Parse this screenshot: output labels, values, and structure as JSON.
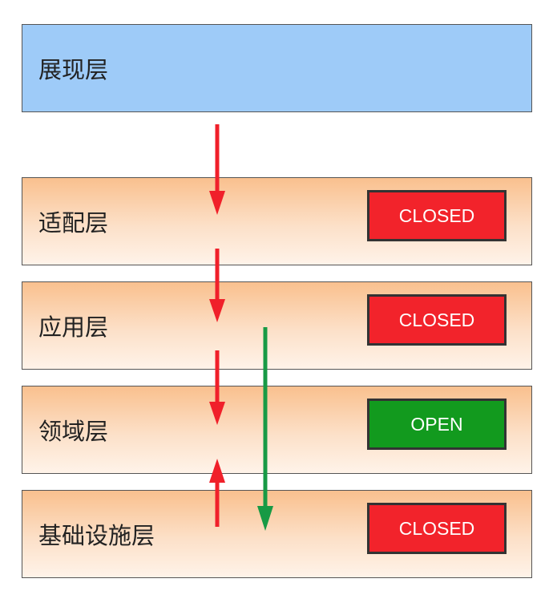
{
  "layers": [
    {
      "id": "presentation",
      "label": "展现层"
    },
    {
      "id": "adapter",
      "label": "适配层",
      "status": "CLOSED"
    },
    {
      "id": "application",
      "label": "应用层",
      "status": "CLOSED"
    },
    {
      "id": "domain",
      "label": "领域层",
      "status": "OPEN"
    },
    {
      "id": "infrastructure",
      "label": "基础设施层",
      "status": "CLOSED"
    }
  ],
  "colors": {
    "presentation_fill": "#9ecbf8",
    "layer_fill_top": "#f9c08e",
    "closed": "#f2232b",
    "open": "#129a1e",
    "red_arrow": "#f0202a",
    "green_arrow": "#179a45"
  }
}
